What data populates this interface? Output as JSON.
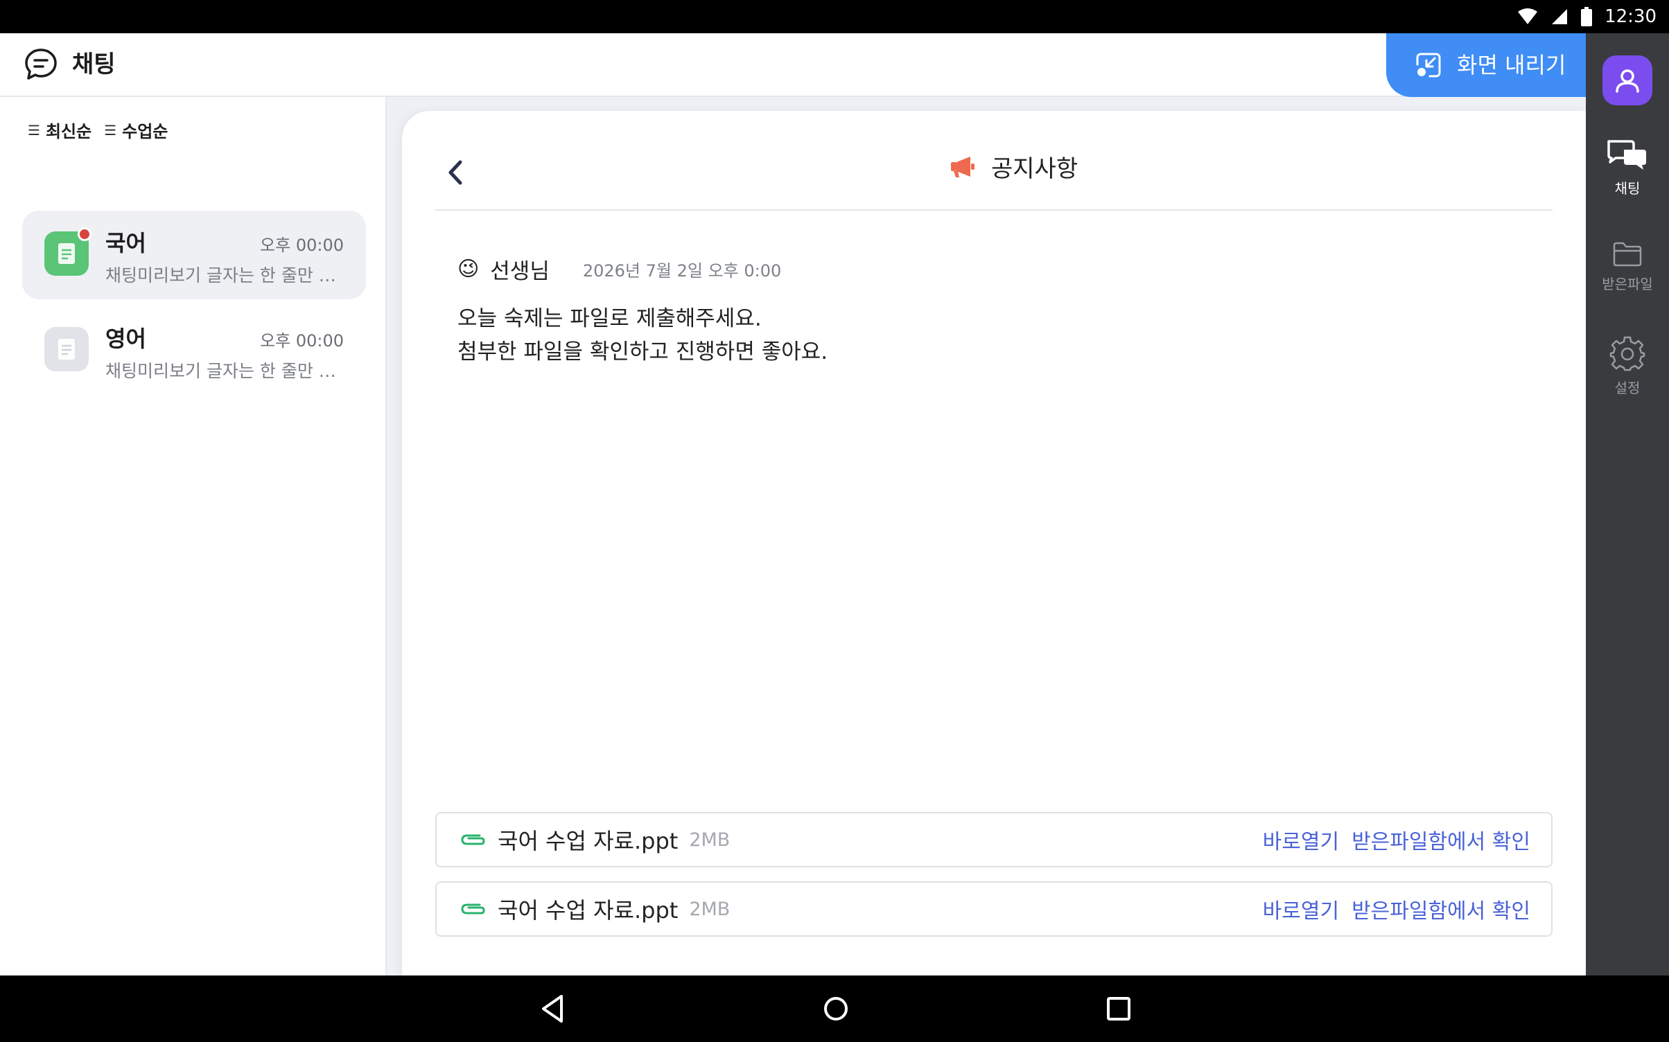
{
  "status_bar": {
    "time": "12:30",
    "icons": [
      "wifi-icon",
      "signal-icon",
      "battery-icon"
    ]
  },
  "header": {
    "title": "채팅",
    "lower_screen_label": "화면 내리기",
    "accent": "#3f8df5"
  },
  "sort": [
    {
      "label": "최신순"
    },
    {
      "label": "수업순"
    }
  ],
  "rooms": [
    {
      "name": "국어",
      "time": "오후 00:00",
      "preview": "채팅미리보기 글자는 한 줄만 보이게 처리",
      "unread": true,
      "color": "#5ac477"
    },
    {
      "name": "영어",
      "time": "오후 00:00",
      "preview": "채팅미리보기 글자는 한 줄만 보이게 처리",
      "unread": false,
      "color": "#e1e3e8"
    }
  ],
  "notice": {
    "title": "공지사항",
    "sender_emoji": "😉",
    "sender": "선생님",
    "date": "2026년 7월 2일 오후 0:00",
    "lines": [
      "오늘 숙제는 파일로 제출해주세요.",
      "첨부한 파일을 확인하고 진행하면 좋아요."
    ]
  },
  "attachments": [
    {
      "name": "국어 수업 자료.ppt",
      "size": "2MB",
      "open": "바로열기",
      "check": "받은파일함에서 확인"
    },
    {
      "name": "국어 수업 자료.ppt",
      "size": "2MB",
      "open": "바로열기",
      "check": "받은파일함에서 확인"
    }
  ],
  "rail": {
    "profile_color": "#7b4dee",
    "items": [
      {
        "label": "채팅",
        "icon": "chat-bubbles-icon",
        "active": true
      },
      {
        "label": "받은파일",
        "icon": "folder-icon",
        "active": false
      },
      {
        "label": "설정",
        "icon": "gear-icon",
        "active": false
      }
    ]
  }
}
